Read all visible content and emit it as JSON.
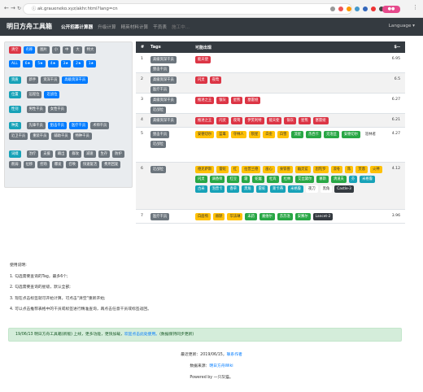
{
  "browser": {
    "url": "ak.graueneko.xyz/akhr.html?lang=cn"
  },
  "brand": {
    "colors": {
      "navbar": "#343a40",
      "red": "#dc3545",
      "blue": "#007bff",
      "gray": "#6c757d",
      "teal": "#17a2b8",
      "gold": "#ffc107",
      "green": "#28a745"
    }
  },
  "navbar": {
    "title": "明日方舟工具箱",
    "links": [
      "公开招募计算器",
      "升级计算",
      "精英材料计算",
      "干员表",
      "施工中..."
    ],
    "lang": "Language ▾"
  },
  "filter": {
    "rows": [
      [
        {
          "label": "清空",
          "c": "red"
        },
        {
          "label": "名称",
          "c": "blue"
        },
        {
          "label": "图片",
          "c": "gray"
        },
        {
          "label": "小",
          "c": "gray"
        },
        {
          "label": "中",
          "c": "gray"
        },
        {
          "label": "大",
          "c": "gray"
        },
        {
          "label": "特大",
          "c": "gray"
        }
      ],
      [
        {
          "label": "ALL",
          "c": "blue"
        },
        {
          "label": "6★",
          "c": "blue"
        },
        {
          "label": "5★",
          "c": "blue"
        },
        {
          "label": "4★",
          "c": "blue"
        },
        {
          "label": "3★",
          "c": "blue"
        },
        {
          "label": "2★",
          "c": "blue"
        },
        {
          "label": "1★",
          "c": "blue"
        }
      ],
      [
        {
          "label": "资质",
          "c": "teal"
        },
        {
          "label": "新手",
          "c": "gray"
        },
        {
          "label": "资深干员",
          "c": "gray"
        },
        {
          "label": "高级资深干员",
          "c": "blue"
        }
      ],
      [
        {
          "label": "位置",
          "c": "teal"
        },
        {
          "label": "远程位",
          "c": "gray"
        },
        {
          "label": "近战位",
          "c": "blue"
        }
      ],
      [
        {
          "label": "性别",
          "c": "teal"
        },
        {
          "label": "男性干员",
          "c": "gray"
        },
        {
          "label": "女性干员",
          "c": "gray"
        }
      ],
      [
        {
          "label": "种类",
          "c": "teal"
        },
        {
          "label": "先锋干员",
          "c": "gray"
        },
        {
          "label": "狙击干员",
          "c": "blue"
        },
        {
          "label": "医疗干员",
          "c": "blue"
        },
        {
          "label": "术师干员",
          "c": "gray"
        },
        {
          "label": "近卫干员",
          "c": "gray"
        },
        {
          "label": "重装干员",
          "c": "gray"
        },
        {
          "label": "辅助干员",
          "c": "gray"
        },
        {
          "label": "特种干员",
          "c": "gray"
        }
      ],
      [
        {
          "label": "词缀",
          "c": "teal"
        },
        {
          "label": "治疗",
          "c": "gray"
        },
        {
          "label": "支援",
          "c": "gray"
        },
        {
          "label": "输出",
          "c": "gray"
        },
        {
          "label": "群攻",
          "c": "gray"
        },
        {
          "label": "减速",
          "c": "gray"
        },
        {
          "label": "生存",
          "c": "gray"
        },
        {
          "label": "防护",
          "c": "gray"
        },
        {
          "label": "削弱",
          "c": "gray"
        },
        {
          "label": "位移",
          "c": "gray"
        },
        {
          "label": "控场",
          "c": "gray"
        },
        {
          "label": "爆发",
          "c": "gray"
        },
        {
          "label": "召唤",
          "c": "gray"
        },
        {
          "label": "快速复活",
          "c": "gray"
        },
        {
          "label": "费用回复",
          "c": "gray"
        }
      ]
    ]
  },
  "table": {
    "headers": {
      "num": "#",
      "tags": "Tags",
      "result": "可能出现",
      "value": "$--"
    },
    "rows": [
      {
        "num": "1",
        "tags": [
          "高级资深干员",
          "狙击干员"
        ],
        "ops": [
          {
            "n": "能天使",
            "c": "red"
          }
        ],
        "val": "6.95"
      },
      {
        "num": "2",
        "tags": [
          "高级资深干员",
          "医疗干员"
        ],
        "ops": [
          {
            "n": "闪灵",
            "c": "red"
          },
          {
            "n": "夜莺",
            "c": "red"
          }
        ],
        "val": "6.5"
      },
      {
        "num": "3",
        "tags": [
          "高级资深干员",
          "近战位"
        ],
        "ops": [
          {
            "n": "推进之王",
            "c": "red"
          },
          {
            "n": "银灰",
            "c": "red"
          },
          {
            "n": "星熊",
            "c": "red"
          },
          {
            "n": "塞雷娅",
            "c": "red"
          }
        ],
        "val": "6.27"
      },
      {
        "num": "4",
        "tags": [
          "高级资深干员"
        ],
        "ops": [
          {
            "n": "推进之王",
            "c": "red"
          },
          {
            "n": "闪灵",
            "c": "red"
          },
          {
            "n": "夜莺",
            "c": "red"
          },
          {
            "n": "伊芙利特",
            "c": "red"
          },
          {
            "n": "能天使",
            "c": "red"
          },
          {
            "n": "银灰",
            "c": "red"
          },
          {
            "n": "星熊",
            "c": "red"
          },
          {
            "n": "塞雷娅",
            "c": "red"
          }
        ],
        "val": "6.21"
      },
      {
        "num": "5",
        "tags": [
          "狙击干员",
          "近战位"
        ],
        "ops": [
          {
            "n": "安德切尔",
            "c": "gold"
          },
          {
            "n": "蓝毒",
            "c": "gold"
          },
          {
            "n": "守林人",
            "c": "gold"
          },
          {
            "n": "陨星",
            "c": "gold"
          },
          {
            "n": "白金",
            "c": "gold"
          },
          {
            "n": "白雪",
            "c": "gold"
          },
          {
            "n": "流星",
            "c": "green"
          },
          {
            "n": "杰西卡",
            "c": "green"
          },
          {
            "n": "克洛丝",
            "c": "green"
          },
          {
            "n": "安德切尔",
            "c": "green"
          },
          {
            "n": "巡林者",
            "c": "light"
          }
        ],
        "val": "4.27"
      },
      {
        "num": "6",
        "tags": [
          "近战位"
        ],
        "ops": [
          {
            "n": "德克萨斯",
            "c": "gold"
          },
          {
            "n": "雷蛇",
            "c": "gold"
          },
          {
            "n": "红",
            "c": "gold"
          },
          {
            "n": "拉普兰德",
            "c": "gold"
          },
          {
            "n": "崖心",
            "c": "gold"
          },
          {
            "n": "食铁兽",
            "c": "gold"
          },
          {
            "n": "幽灵鲨",
            "c": "gold"
          },
          {
            "n": "因陀罗",
            "c": "gold"
          },
          {
            "n": "凛冬",
            "c": "gold"
          },
          {
            "n": "陈",
            "c": "gold"
          },
          {
            "n": "芙蓉",
            "c": "gold"
          },
          {
            "n": "火神",
            "c": "gold"
          },
          {
            "n": "闪灵",
            "c": "green"
          },
          {
            "n": "调香师",
            "c": "green"
          },
          {
            "n": "红豆",
            "c": "green"
          },
          {
            "n": "霜",
            "c": "green"
          },
          {
            "n": "蛇屠",
            "c": "green"
          },
          {
            "n": "杜宾",
            "c": "green"
          },
          {
            "n": "杜林",
            "c": "green"
          },
          {
            "n": "艾丝黛尔",
            "c": "green"
          },
          {
            "n": "慕斯",
            "c": "green"
          },
          {
            "n": "清道夫",
            "c": "green"
          },
          {
            "n": "芬",
            "c": "teal"
          },
          {
            "n": "米格鲁",
            "c": "teal"
          },
          {
            "n": "古米",
            "c": "teal"
          },
          {
            "n": "泡普卡",
            "c": "teal"
          },
          {
            "n": "香草",
            "c": "teal"
          },
          {
            "n": "黑角",
            "c": "teal"
          },
          {
            "n": "雷蛇",
            "c": "teal"
          },
          {
            "n": "斯卡蒂",
            "c": "teal"
          },
          {
            "n": "米格鲁",
            "c": "teal"
          },
          {
            "n": "夜刀",
            "c": "light"
          },
          {
            "n": "黑角",
            "c": "light"
          },
          {
            "n": "Castle-3",
            "c": "dark"
          }
        ],
        "val": "4.12"
      },
      {
        "num": "7",
        "tags": [
          "医疗干员"
        ],
        "ops": [
          {
            "n": "白面鸮",
            "c": "gold"
          },
          {
            "n": "赫默",
            "c": "gold"
          },
          {
            "n": "华法琳",
            "c": "gold"
          },
          {
            "n": "末药",
            "c": "green"
          },
          {
            "n": "嘉维尔",
            "c": "green"
          },
          {
            "n": "苏苏洛",
            "c": "green"
          },
          {
            "n": "安赛尔",
            "c": "green"
          },
          {
            "n": "Lancet-2",
            "c": "dark"
          }
        ],
        "val": "3.96"
      }
    ]
  },
  "usage": {
    "title": "使用说明:",
    "items": [
      "1. 勾选需要查询的Tag，最多6个;",
      "2. 勾选需要查询的星级，默认全部;",
      "3. 现在点击标签就可开始计算，可点击\"清空\"重新开始;",
      "4. 可以点击推荐表格中的干员或标签进行精准查询，再点击任意干员或标签返回。"
    ]
  },
  "alert": {
    "text": "19/06/13 明日方舟工具箱(新版) 上线，更多功能，更快加载，",
    "link": "欢迎点击此处使用。",
    "suffix": "(数据保持同步更新)"
  },
  "footer": {
    "updated_prefix": "最近更新：2019/06/15，",
    "author_link": "联系作者",
    "source_prefix": "数据来源：",
    "source_link": "明日方舟Wiki",
    "powered": "Powered by 一只灰猫。"
  }
}
